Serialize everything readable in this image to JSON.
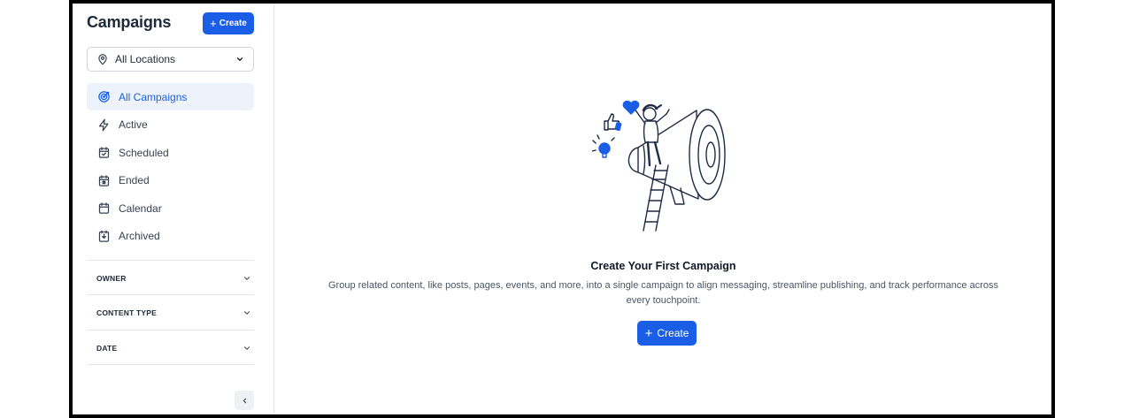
{
  "sidebar": {
    "title": "Campaigns",
    "create_label": "Create",
    "location_select": {
      "value": "All Locations",
      "icon": "map-pin-icon"
    },
    "nav_items": [
      {
        "label": "All Campaigns",
        "icon": "target-icon",
        "active": true
      },
      {
        "label": "Active",
        "icon": "lightning-icon",
        "active": false
      },
      {
        "label": "Scheduled",
        "icon": "calendar-check-icon",
        "active": false
      },
      {
        "label": "Ended",
        "icon": "calendar-stop-icon",
        "active": false
      },
      {
        "label": "Calendar",
        "icon": "calendar-icon",
        "active": false
      },
      {
        "label": "Archived",
        "icon": "archive-icon",
        "active": false
      }
    ],
    "filters": [
      {
        "label": "OWNER"
      },
      {
        "label": "CONTENT TYPE"
      },
      {
        "label": "DATE"
      }
    ],
    "collapse_icon": "chevron-left-icon"
  },
  "main": {
    "empty_state": {
      "illustration": "megaphone-ladder-illustration",
      "title": "Create Your First Campaign",
      "description": "Group related content, like posts, pages, events, and more, into a single campaign to align messaging, streamline publishing, and track performance across every touchpoint.",
      "create_label": "Create"
    }
  },
  "colors": {
    "accent": "#1a5ee6",
    "active_bg": "#eef3fb",
    "border": "#e5e7eb"
  }
}
